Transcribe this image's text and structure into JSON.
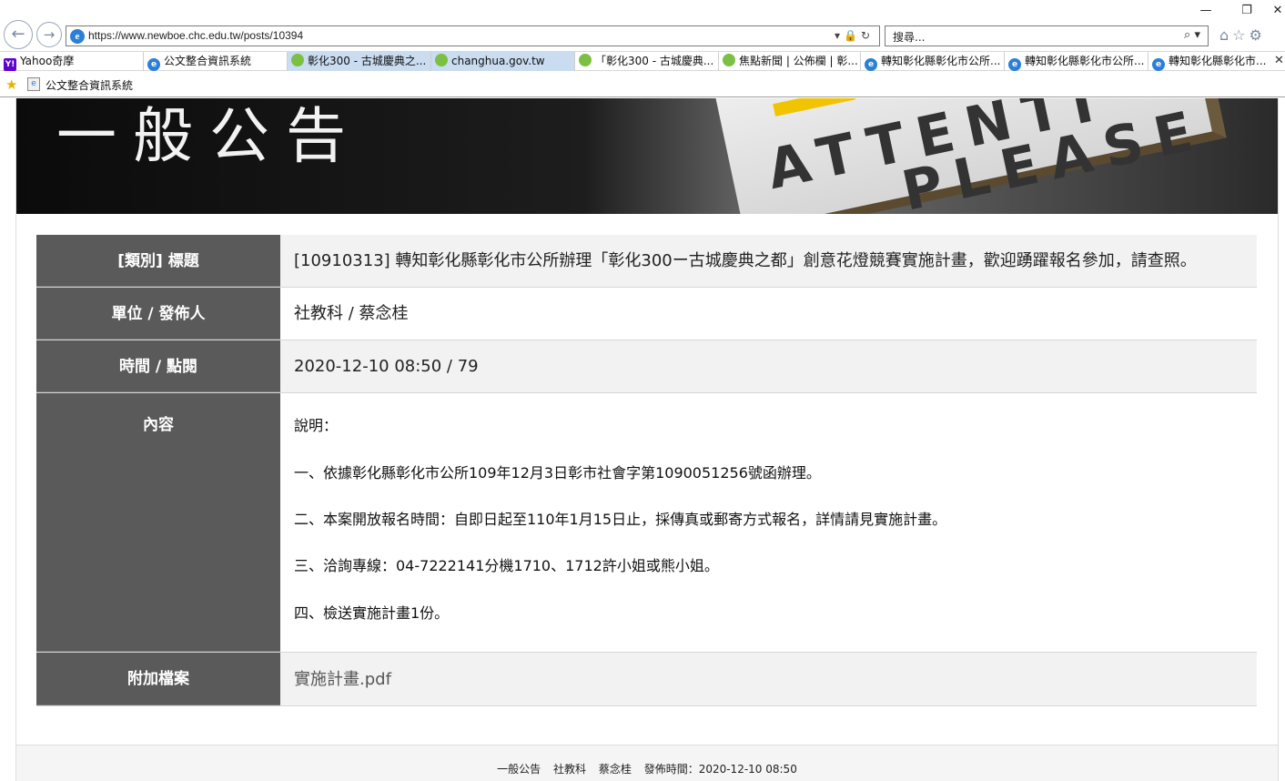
{
  "browser": {
    "url": "https://www.newboe.chc.edu.tw/posts/10394",
    "search_placeholder": "搜尋...",
    "tabs": [
      {
        "label": "Yahoo奇摩",
        "icon": "yahoo-icon"
      },
      {
        "label": "公文整合資訊系統",
        "icon": "ie-icon"
      },
      {
        "label": "彰化300 - 古城慶典之...",
        "icon": "changhua-icon"
      },
      {
        "label": "changhua.gov.tw",
        "icon": "changhua-icon"
      },
      {
        "label": "「彰化300 - 古城慶典...",
        "icon": "changhua-icon"
      },
      {
        "label": "焦點新聞 | 公佈欄 | 彰...",
        "icon": "changhua-icon"
      },
      {
        "label": "轉知彰化縣彰化市公所...",
        "icon": "ie-icon"
      },
      {
        "label": "轉知彰化縣彰化市公所...",
        "icon": "ie-icon"
      },
      {
        "label": "轉知彰化縣彰化市...",
        "icon": "ie-icon"
      }
    ],
    "favorites": {
      "label": "公文整合資訊系統"
    }
  },
  "banner": {
    "title": "一般公告",
    "sign_line1": "ATTENTI",
    "sign_line2": "PLEASE"
  },
  "post": {
    "rows": [
      {
        "label": "[類別] 標題",
        "value": "[10910313] 轉知彰化縣彰化市公所辦理「彰化300ー古城慶典之都」創意花燈競賽實施計畫，歡迎踴躍報名參加，請查照。"
      },
      {
        "label": "單位 / 發佈人",
        "value": "社教科 / 蔡念桂"
      },
      {
        "label": "時間 / 點閱",
        "value": "2020-12-10 08:50 / 79"
      },
      {
        "label": "內容",
        "lines": [
          "說明：",
          "一、依據彰化縣彰化市公所109年12月3日彰市社會字第1090051256號函辦理。",
          "二、本案開放報名時間：自即日起至110年1月15日止，採傳真或郵寄方式報名，詳情請見實施計畫。",
          "三、洽詢專線：04-7222141分機1710、1712許小姐或熊小姐。",
          "四、檢送實施計畫1份。"
        ]
      },
      {
        "label": "附加檔案",
        "value": "實施計畫.pdf"
      }
    ]
  },
  "footer": {
    "category": "一般公告",
    "unit": "社教科",
    "author": "蔡念桂",
    "published": "發佈時間：2020-12-10 08:50"
  }
}
